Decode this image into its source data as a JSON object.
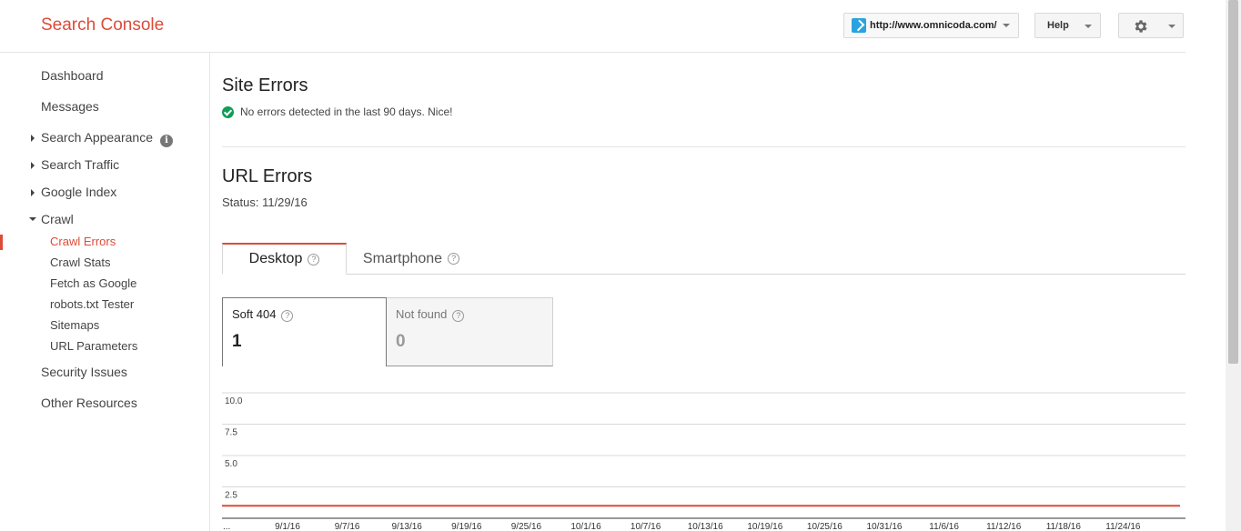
{
  "header": {
    "logo": "Search Console",
    "site": "http://www.omnicoda.com/",
    "help_label": "Help"
  },
  "sidebar": {
    "dashboard": "Dashboard",
    "messages": "Messages",
    "search_appearance": "Search Appearance",
    "search_traffic": "Search Traffic",
    "google_index": "Google Index",
    "crawl": "Crawl",
    "crawl_items": [
      "Crawl Errors",
      "Crawl Stats",
      "Fetch as Google",
      "robots.txt Tester",
      "Sitemaps",
      "URL Parameters"
    ],
    "security_issues": "Security Issues",
    "other_resources": "Other Resources"
  },
  "site_errors": {
    "title": "Site Errors",
    "message": "No errors detected in the last 90 days. Nice!"
  },
  "url_errors": {
    "title": "URL Errors",
    "status": "Status: 11/29/16",
    "tabs": [
      "Desktop",
      "Smartphone"
    ],
    "metrics": [
      {
        "label": "Soft 404",
        "value": "1"
      },
      {
        "label": "Not found",
        "value": "0"
      }
    ]
  },
  "colors": {
    "accent": "#dd4b39",
    "ok": "#0f9d58",
    "series": "#dd4b39"
  },
  "chart_data": {
    "type": "line",
    "y_ticks": [
      "10.0",
      "7.5",
      "5.0",
      "2.5"
    ],
    "ylim": [
      0,
      10
    ],
    "x_first_label": "...",
    "x": [
      "9/1/16",
      "9/7/16",
      "9/13/16",
      "9/19/16",
      "9/25/16",
      "10/1/16",
      "10/7/16",
      "10/13/16",
      "10/19/16",
      "10/25/16",
      "10/31/16",
      "11/6/16",
      "11/12/16",
      "11/18/16",
      "11/24/16"
    ],
    "series": [
      {
        "values": [
          1,
          1,
          1,
          1,
          1,
          1,
          1,
          1,
          1,
          1,
          1,
          1,
          1,
          1,
          1
        ]
      }
    ],
    "grid": true
  }
}
